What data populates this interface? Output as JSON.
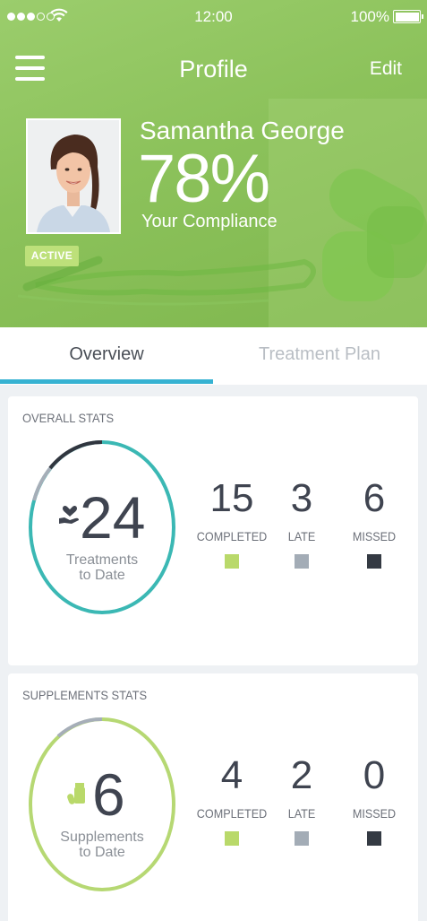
{
  "status_bar": {
    "time": "12:00",
    "battery": "100%"
  },
  "nav": {
    "title": "Profile",
    "edit_label": "Edit"
  },
  "profile": {
    "name": "Samantha George",
    "compliance_value": "78%",
    "compliance_label": "Your Compliance",
    "status_badge": "ACTIVE"
  },
  "tabs": [
    {
      "label": "Overview",
      "active": true
    },
    {
      "label": "Treatment Plan",
      "active": false
    }
  ],
  "overall_stats": {
    "title": "OVERALL STATS",
    "total": "24",
    "caption_line1": "Treatments",
    "caption_line2": "to Date",
    "icon": "heart-in-hand-icon",
    "stats": [
      {
        "value": "15",
        "label": "COMPLETED",
        "color": "#b9d96a"
      },
      {
        "value": "3",
        "label": "LATE",
        "color": "#a3acb6"
      },
      {
        "value": "6",
        "label": "MISSED",
        "color": "#343a43"
      }
    ]
  },
  "supplements_stats": {
    "title": "SUPPLEMENTS STATS",
    "total": "6",
    "caption_line1": "Supplements",
    "caption_line2": "to Date",
    "icon": "pill-bottle-icon",
    "stats": [
      {
        "value": "4",
        "label": "COMPLETED",
        "color": "#b9d96a"
      },
      {
        "value": "2",
        "label": "LATE",
        "color": "#a3acb6"
      },
      {
        "value": "0",
        "label": "MISSED",
        "color": "#343a43"
      }
    ]
  },
  "colors": {
    "header_green": "#8cc25b",
    "tab_accent": "#36b2d2",
    "overall_ring": "#3bb8b4",
    "supplements_ring": "#b6d873"
  }
}
